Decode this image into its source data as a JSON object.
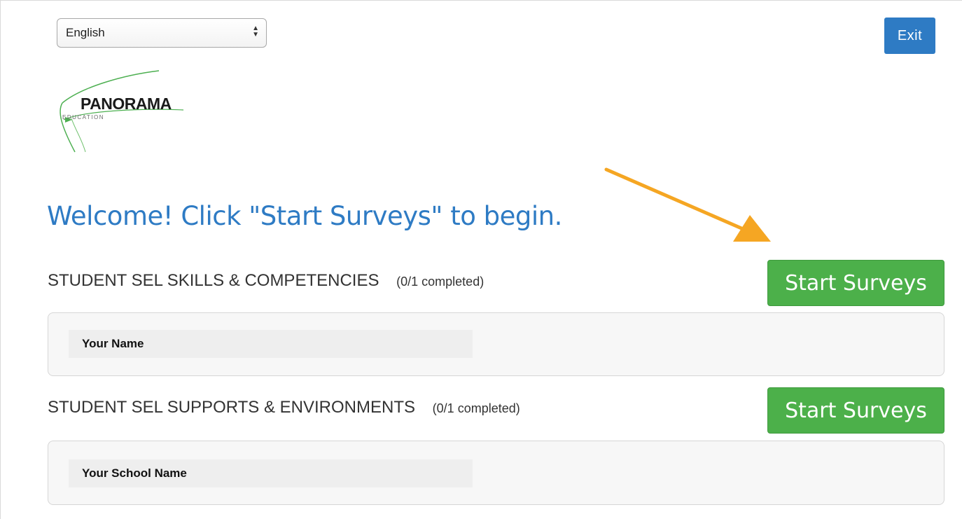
{
  "language_select": {
    "value": "English"
  },
  "header": {
    "exit_label": "Exit"
  },
  "logo": {
    "brand": "PANORAMA",
    "sub": "EDUCATION"
  },
  "welcome": {
    "text": "Welcome! Click \"Start Surveys\" to begin."
  },
  "sections": [
    {
      "title": "STUDENT SEL SKILLS & COMPETENCIES",
      "count": "(0/1 completed)",
      "button_label": "Start Surveys",
      "item_label": "Your Name"
    },
    {
      "title": "STUDENT SEL SUPPORTS & ENVIRONMENTS",
      "count": "(0/1 completed)",
      "button_label": "Start Surveys",
      "item_label": "Your School Name"
    }
  ],
  "colors": {
    "primary_blue": "#2e7bc4",
    "start_green": "#4cb04a",
    "annotation_arrow": "#f5a623"
  }
}
